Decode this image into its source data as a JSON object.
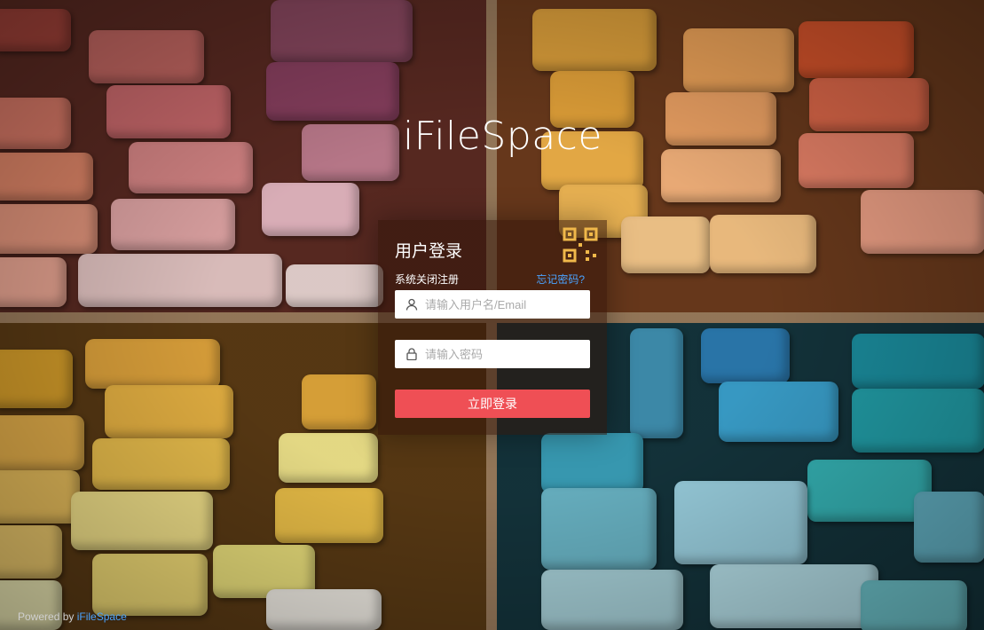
{
  "brand": {
    "name": "iFileSpace"
  },
  "login": {
    "title": "用户登录",
    "registration_note": "系统关闭注册",
    "forgot_password": "忘记密码?",
    "username_placeholder": "请输入用户名/Email",
    "password_placeholder": "请输入密码",
    "submit_label": "立即登录"
  },
  "footer": {
    "prefix": "Powered by",
    "link": "iFileSpace"
  },
  "colors": {
    "primary_button": "#ef4f55",
    "link": "#4aa3ff"
  },
  "icons": {
    "qr": "qr-code-icon",
    "user": "user-icon",
    "lock": "lock-icon"
  }
}
